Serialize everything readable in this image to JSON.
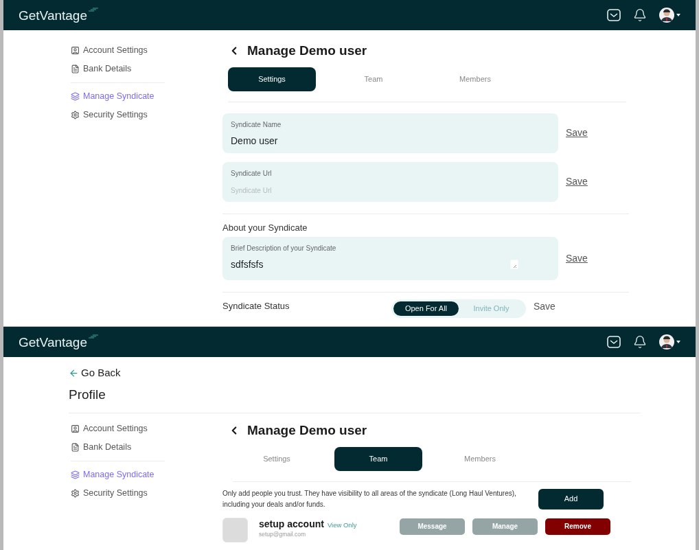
{
  "screens": [
    {
      "header": {
        "logo": "GetVantage"
      },
      "sidebar": [
        {
          "label": "Account Settings",
          "kind": "account",
          "selected": false
        },
        {
          "label": "Bank Details",
          "kind": "bank",
          "selected": false
        },
        {
          "label": "Manage Syndicate",
          "kind": "syndicate",
          "selected": true
        },
        {
          "label": "Security Settings",
          "kind": "security",
          "selected": false
        }
      ],
      "manage": {
        "title": "Manage Demo user",
        "tabs": [
          {
            "label": "Settings",
            "selected": true
          },
          {
            "label": "Team",
            "selected": false
          },
          {
            "label": "Members",
            "selected": false
          }
        ],
        "content": {
          "kind": "settings",
          "rows": [
            {
              "kind": "field",
              "label": "Syndicate Name",
              "value": "Demo user",
              "save": "Save"
            },
            {
              "kind": "field",
              "label": "Syndicate Url",
              "placeholder": "Syndicate Url",
              "save": "Save"
            },
            {
              "kind": "textarea",
              "heading": "About your Syndicate",
              "label": "Brief Description of your Syndicate",
              "value": "sdfsfsfs",
              "save": "Save"
            },
            {
              "kind": "toggle",
              "label": "Syndicate Status",
              "options": [
                {
                  "label": "Open For All",
                  "selected": true
                },
                {
                  "label": "Invite Only",
                  "selected": false
                }
              ],
              "save": "Save"
            }
          ]
        }
      }
    },
    {
      "header": {
        "logo": "GetVantage"
      },
      "go_back": "Go Back",
      "page_title": "Profile",
      "sidebar": [
        {
          "label": "Account Settings",
          "kind": "account",
          "selected": false
        },
        {
          "label": "Bank Details",
          "kind": "bank",
          "selected": false
        },
        {
          "label": "Manage Syndicate",
          "kind": "syndicate",
          "selected": true
        },
        {
          "label": "Security Settings",
          "kind": "security",
          "selected": false
        }
      ],
      "manage": {
        "title": "Manage Demo user",
        "tabs": [
          {
            "label": "Settings",
            "selected": false
          },
          {
            "label": "Team",
            "selected": true
          },
          {
            "label": "Members",
            "selected": false
          }
        ],
        "content": {
          "kind": "team",
          "notice": "Only add people you trust. They have visibility to all areas of the syndicate (Long Haul Ventures), including your deals and/or funds.",
          "add": "Add",
          "members": [
            {
              "name": "setup account",
              "role": "View Only",
              "email": "setup@gmail.com",
              "actions": [
                {
                  "label": "Message",
                  "kind": "neutral"
                },
                {
                  "label": "Manage",
                  "kind": "neutral"
                },
                {
                  "label": "Remove",
                  "kind": "danger"
                }
              ]
            }
          ]
        }
      }
    }
  ]
}
